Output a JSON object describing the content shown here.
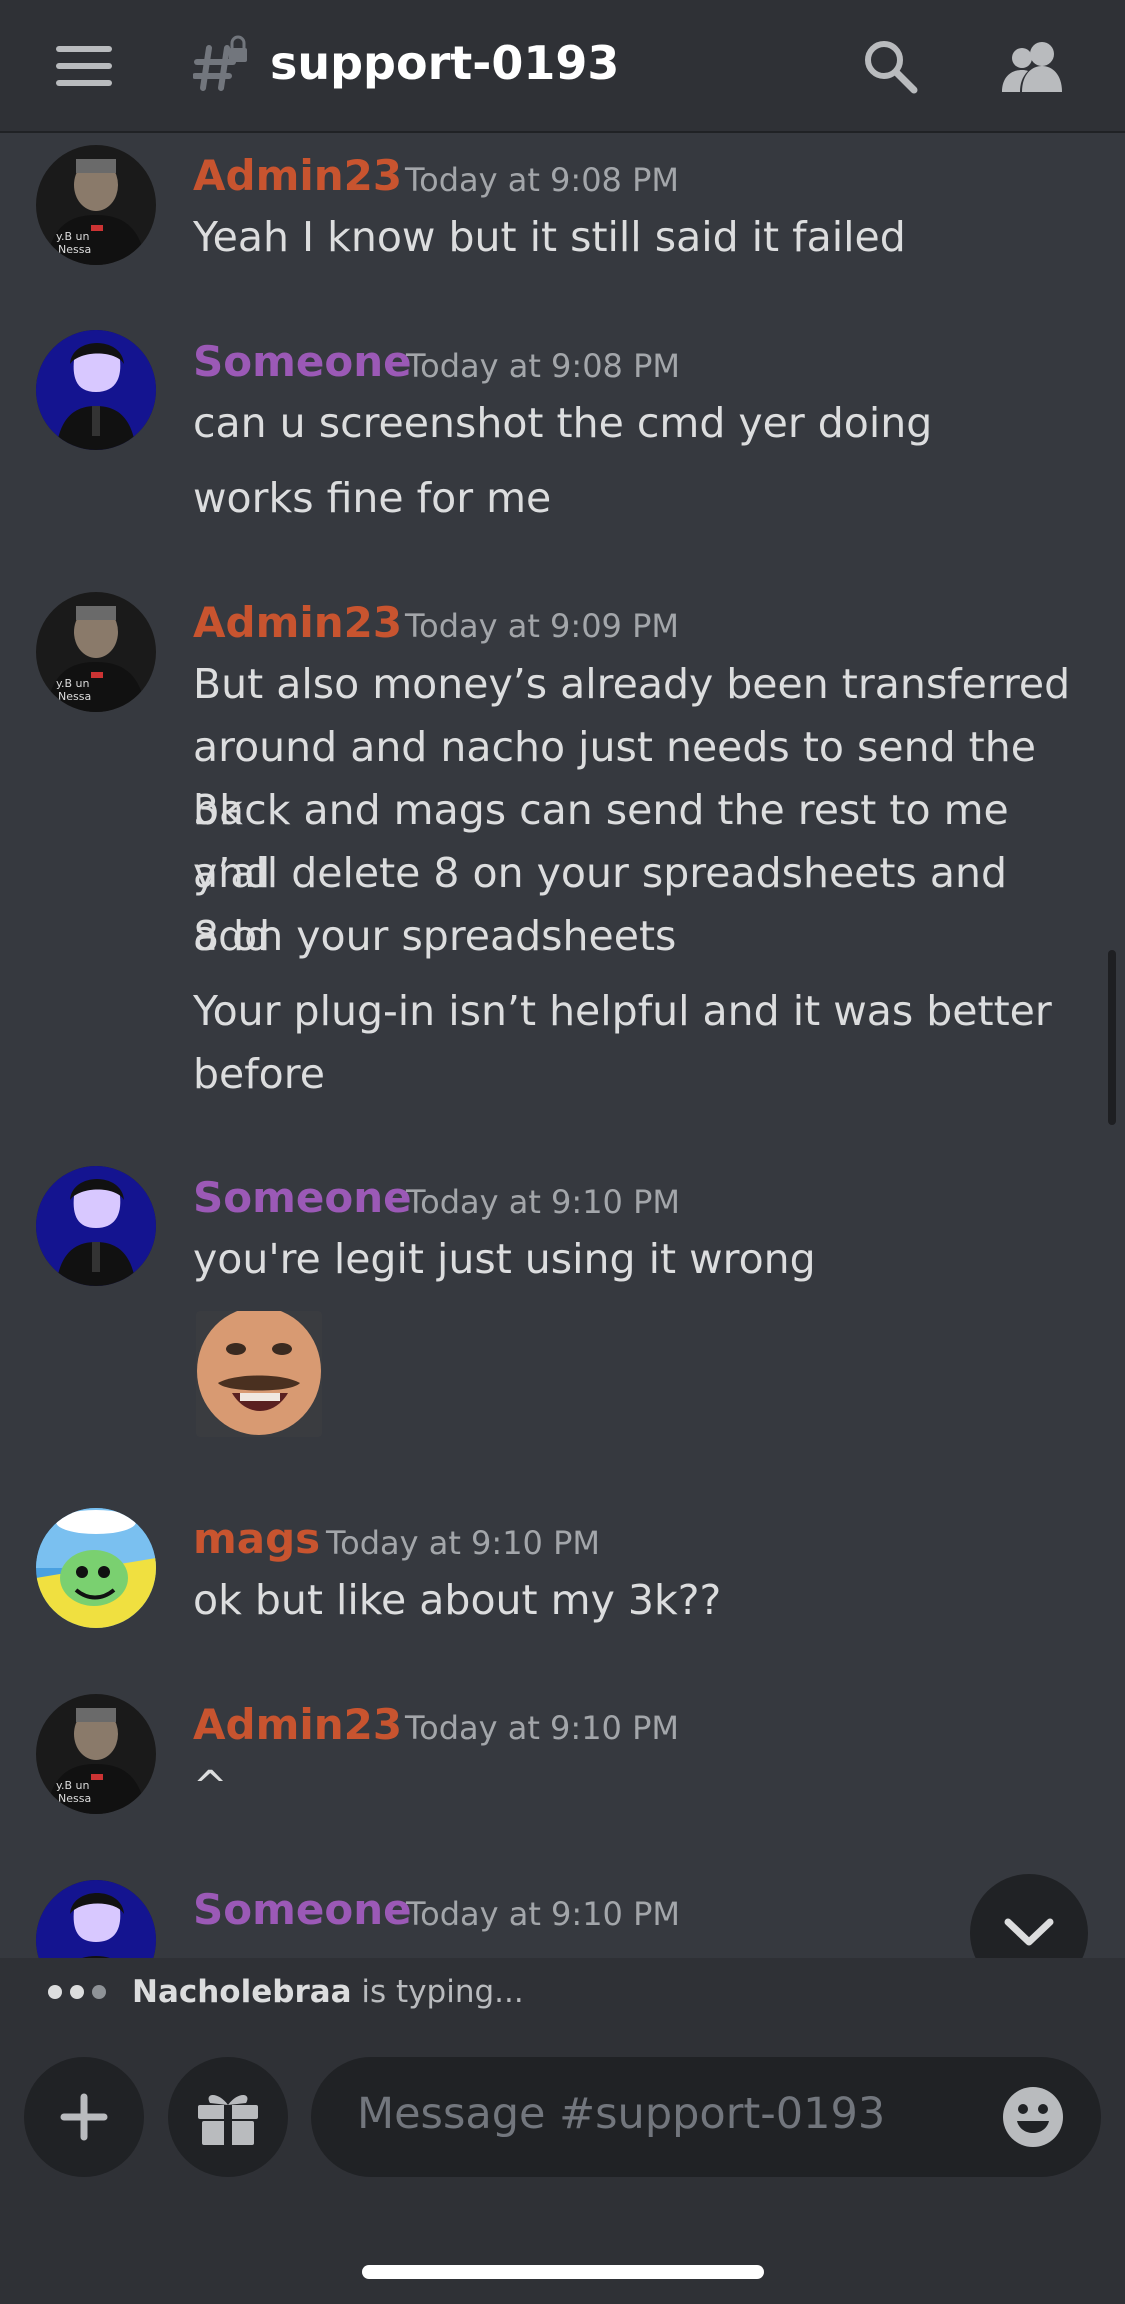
{
  "channel": {
    "name": "support-0193"
  },
  "messages": [
    {
      "author": "Admin23",
      "time": "Today at 9:08 PM",
      "lines": [
        "Yeah I know but it still said it failed"
      ]
    },
    {
      "author": "Someone",
      "time": "Today at 9:08 PM",
      "lines": [
        "can u screenshot the cmd yer doing",
        "works fine for me"
      ]
    },
    {
      "author": "Admin23",
      "time": "Today at 9:09 PM",
      "lines": [
        "But also money’s already been transferred",
        "around and nacho just needs to send the 3k",
        "back and mags can send the rest to me and",
        "y’all delete 8 on your spreadsheets and add",
        "8 on your spreadsheets",
        "Your plug-in isn’t helpful and it was better",
        "before"
      ]
    },
    {
      "author": "Someone",
      "time": "Today at 9:10 PM",
      "lines": [
        "you're legit just using it wrong"
      ]
    },
    {
      "author": "mags",
      "time": "Today at 9:10 PM",
      "lines": [
        "ok but like about my 3k??"
      ]
    },
    {
      "author": "Admin23",
      "time": "Today at 9:10 PM",
      "lines": [
        "^"
      ]
    },
    {
      "author": "Someone",
      "time": "Today at 9:10 PM",
      "lines": []
    }
  ],
  "typing": {
    "user": "Nacholebraa",
    "suffix": " is typing..."
  },
  "composer": {
    "placeholder": "Message #support-0193"
  },
  "colors": {
    "admin": "#c8542f",
    "someone": "#9b59b6",
    "background": "#36393f",
    "header": "#2f3136"
  },
  "icons": [
    "menu-icon",
    "locked-channel-icon",
    "search-icon",
    "members-icon",
    "plus-icon",
    "gift-icon",
    "emoji-icon",
    "chevron-down-icon"
  ]
}
